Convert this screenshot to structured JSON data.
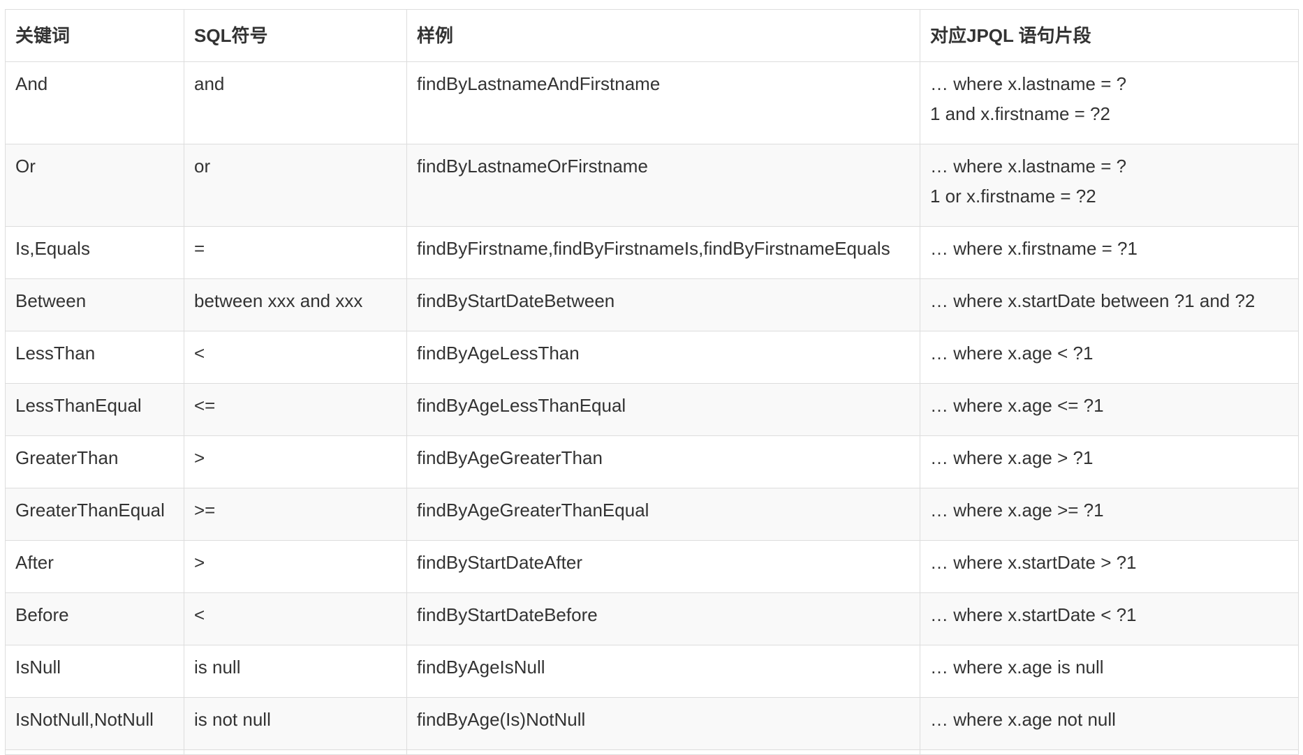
{
  "table": {
    "headers": [
      "关键词",
      "SQL符号",
      "样例",
      "对应JPQL 语句片段"
    ],
    "rows": [
      {
        "keyword": "And",
        "sql": "and",
        "example": "findByLastnameAndFirstname",
        "jpql": [
          "… where x.lastname = ?",
          "1 and x.firstname = ?2"
        ]
      },
      {
        "keyword": "Or",
        "sql": "or",
        "example": "findByLastnameOrFirstname",
        "jpql": [
          "… where x.lastname = ?",
          "1 or x.firstname = ?2"
        ]
      },
      {
        "keyword": "Is,Equals",
        "sql": "=",
        "example": "findByFirstname,findByFirstnameIs,findByFirstnameEquals",
        "jpql": [
          "… where x.firstname = ?1"
        ]
      },
      {
        "keyword": "Between",
        "sql": "between xxx and xxx",
        "example": "findByStartDateBetween",
        "jpql": [
          "… where x.startDate between ?1 and ?2"
        ]
      },
      {
        "keyword": "LessThan",
        "sql": "<",
        "example": "findByAgeLessThan",
        "jpql": [
          "… where x.age < ?1"
        ]
      },
      {
        "keyword": "LessThanEqual",
        "sql": "<=",
        "example": "findByAgeLessThanEqual",
        "jpql": [
          "… where x.age <= ?1"
        ]
      },
      {
        "keyword": "GreaterThan",
        "sql": ">",
        "example": "findByAgeGreaterThan",
        "jpql": [
          "… where x.age > ?1"
        ]
      },
      {
        "keyword": "GreaterThanEqual",
        "sql": ">=",
        "example": "findByAgeGreaterThanEqual",
        "jpql": [
          "… where x.age >= ?1"
        ]
      },
      {
        "keyword": "After",
        "sql": ">",
        "example": "findByStartDateAfter",
        "jpql": [
          "… where x.startDate > ?1"
        ]
      },
      {
        "keyword": "Before",
        "sql": "<",
        "example": "findByStartDateBefore",
        "jpql": [
          "… where x.startDate < ?1"
        ]
      },
      {
        "keyword": "IsNull",
        "sql": "is null",
        "example": "findByAgeIsNull",
        "jpql": [
          "… where x.age is null"
        ]
      },
      {
        "keyword": "IsNotNull,NotNull",
        "sql": "is not null",
        "example": "findByAge(Is)NotNull",
        "jpql": [
          "… where x.age not null"
        ]
      }
    ]
  }
}
